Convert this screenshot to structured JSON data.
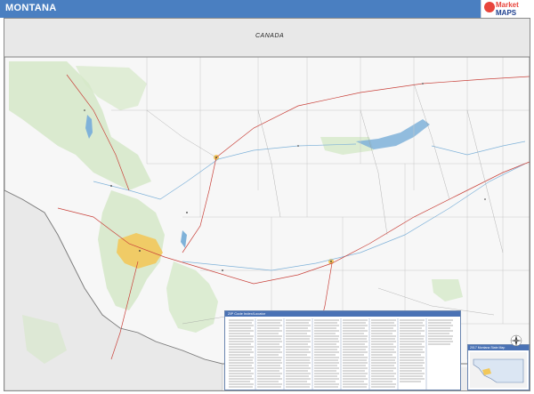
{
  "header": {
    "title": "MONTANA"
  },
  "logo": {
    "word_a": "Market",
    "word_b": "MAPS",
    "icon": "market-maps-logo"
  },
  "map": {
    "country_north": "CANADA",
    "colors": {
      "title_bar": "#4a7fc1",
      "land": "#f7f7f7",
      "forest": "#d5e8c8",
      "metro": "#f2c85a",
      "water": "#7fb2d9",
      "roads_major": "#c9423b",
      "county_lines": "#c8c8c8"
    }
  },
  "index_panel": {
    "title": "ZIP Code Index/Locator"
  },
  "inset": {
    "title": "2017 Montana State Map"
  }
}
